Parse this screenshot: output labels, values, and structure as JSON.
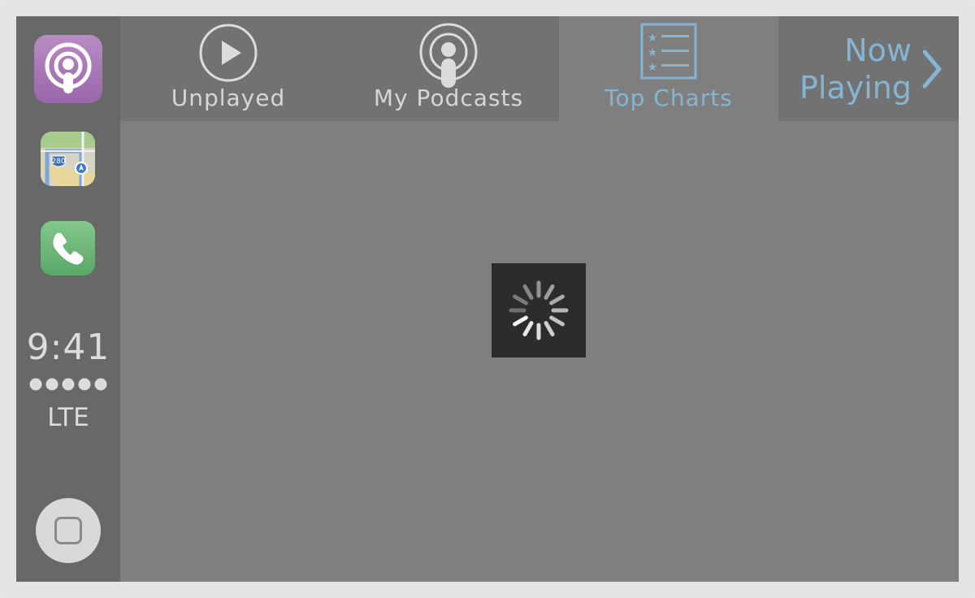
{
  "sidebar": {
    "apps": [
      {
        "name": "Podcasts",
        "icon": "podcasts-app-icon"
      },
      {
        "name": "Maps",
        "icon": "maps-app-icon"
      },
      {
        "name": "Phone",
        "icon": "phone-app-icon"
      }
    ],
    "maps_highway": "280",
    "clock": "9:41",
    "signal_bars": 5,
    "network": "LTE"
  },
  "tabs": [
    {
      "label": "Unplayed",
      "icon": "play-circle-icon",
      "selected": false
    },
    {
      "label": "My Podcasts",
      "icon": "podcast-broadcast-icon",
      "selected": false
    },
    {
      "label": "Top Charts",
      "icon": "star-list-icon",
      "selected": true
    }
  ],
  "now_playing": {
    "line1": "Now",
    "line2": "Playing",
    "icon": "chevron-right-icon"
  },
  "loading": {
    "icon": "activity-spinner-icon"
  },
  "colors": {
    "accent": "#86b4d3",
    "screen_bg": "#7f7f7f",
    "sidebar_bg": "#686868",
    "tab_text": "#d6d6d6"
  }
}
